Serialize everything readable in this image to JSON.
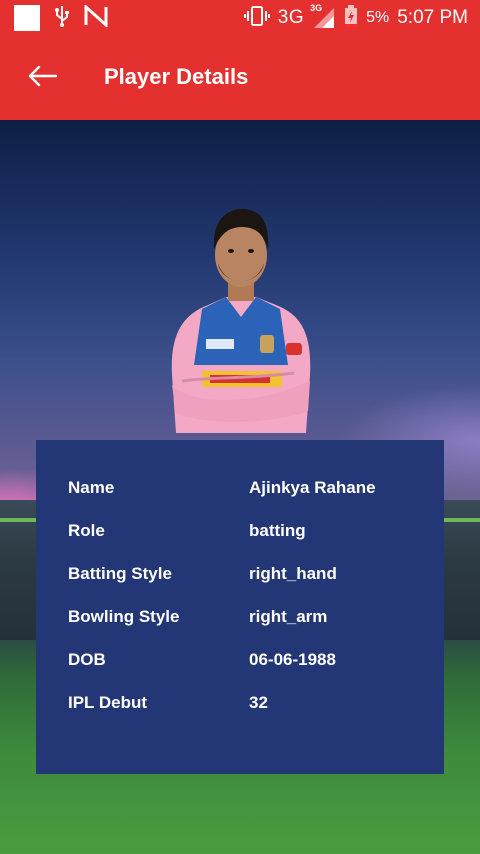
{
  "status_bar": {
    "network": "3G",
    "network_badge": "3G",
    "battery": "5%",
    "time": "5:07 PM"
  },
  "app_bar": {
    "title": "Player Details"
  },
  "details": [
    {
      "label": "Name",
      "value": "Ajinkya Rahane"
    },
    {
      "label": "Role",
      "value": "batting"
    },
    {
      "label": "Batting Style",
      "value": "right_hand"
    },
    {
      "label": "Bowling Style",
      "value": "right_arm"
    },
    {
      "label": "DOB",
      "value": "06-06-1988"
    },
    {
      "label": "IPL Debut",
      "value": "32"
    }
  ],
  "colors": {
    "primary": "#e53030",
    "card": "#233675"
  }
}
